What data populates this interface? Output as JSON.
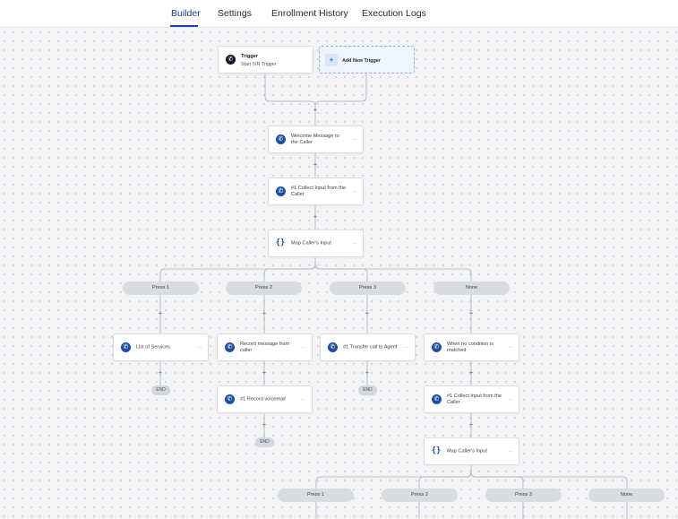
{
  "tabs": [
    "Builder",
    "Settings",
    "Enrollment History",
    "Execution Logs"
  ],
  "active_tab": "Builder",
  "trigger": {
    "title": "Trigger",
    "subtitle": "Start IVR Trigger",
    "icon": "phone-icon"
  },
  "add_trigger": {
    "label": "Add New Trigger",
    "icon": "plus-icon"
  },
  "nodes": {
    "welcome": {
      "label": "Welcome Message to the Caller",
      "icon": "phone-icon"
    },
    "collect1": {
      "label": "#1 Collect Input from the Caller",
      "icon": "phone-icon"
    },
    "map1": {
      "label": "Map Caller's Input",
      "icon": "braces-icon"
    },
    "list_services": {
      "label": "List of Services",
      "icon": "phone-icon"
    },
    "record_message": {
      "label": "Record message from caller",
      "icon": "phone-icon"
    },
    "transfer": {
      "label": "#1 Transfer call to Agent",
      "icon": "phone-icon"
    },
    "no_condition": {
      "label": "When no condition is matched",
      "icon": "phone-icon"
    },
    "record_voicemail": {
      "label": "#1 Record voicemail",
      "icon": "phone-icon"
    },
    "collect2": {
      "label": "#1 Collect Input from the Caller",
      "icon": "phone-icon"
    },
    "map2": {
      "label": "Map Caller's Input",
      "icon": "braces-icon"
    }
  },
  "branches_level1": [
    "Press 1",
    "Press 2",
    "Press 3",
    "None"
  ],
  "branches_level2": [
    "Press 1",
    "Press 2",
    "Press 3",
    "None"
  ],
  "end_label": "END",
  "menu_glyph": "···",
  "plus_glyph": "+",
  "colors": {
    "accent": "#1e4fa3",
    "pill": "#d9dce1",
    "canvas": "#f3f4f6",
    "add_trigger_bg": "#eef5fd"
  }
}
